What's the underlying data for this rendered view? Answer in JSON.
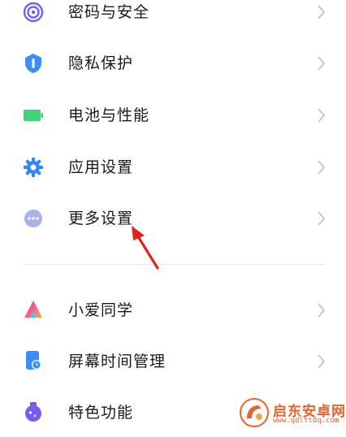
{
  "settings": {
    "items": [
      {
        "label": "密码与安全",
        "icon": "fingerprint-icon"
      },
      {
        "label": "隐私保护",
        "icon": "privacy-shield-icon"
      },
      {
        "label": "电池与性能",
        "icon": "battery-icon"
      },
      {
        "label": "应用设置",
        "icon": "gear-icon"
      },
      {
        "label": "更多设置",
        "icon": "more-dots-icon"
      },
      {
        "label": "小爱同学",
        "icon": "xiaoai-icon"
      },
      {
        "label": "屏幕时间管理",
        "icon": "screen-time-icon"
      },
      {
        "label": "特色功能",
        "icon": "feature-flask-icon"
      }
    ]
  },
  "watermark": {
    "title": "启东安卓网",
    "url": "www.qdlttdq.com"
  },
  "colors": {
    "fingerprint": "#6c63ff",
    "privacy": "#3a8dfa",
    "battery": "#3ed47a",
    "gear": "#2f86f6",
    "more": "#a7b4e8",
    "screen_time": "#3a8dfa",
    "feature": "#7a5cf0",
    "arrow": "#e2231a",
    "watermark": "#e8622c"
  }
}
